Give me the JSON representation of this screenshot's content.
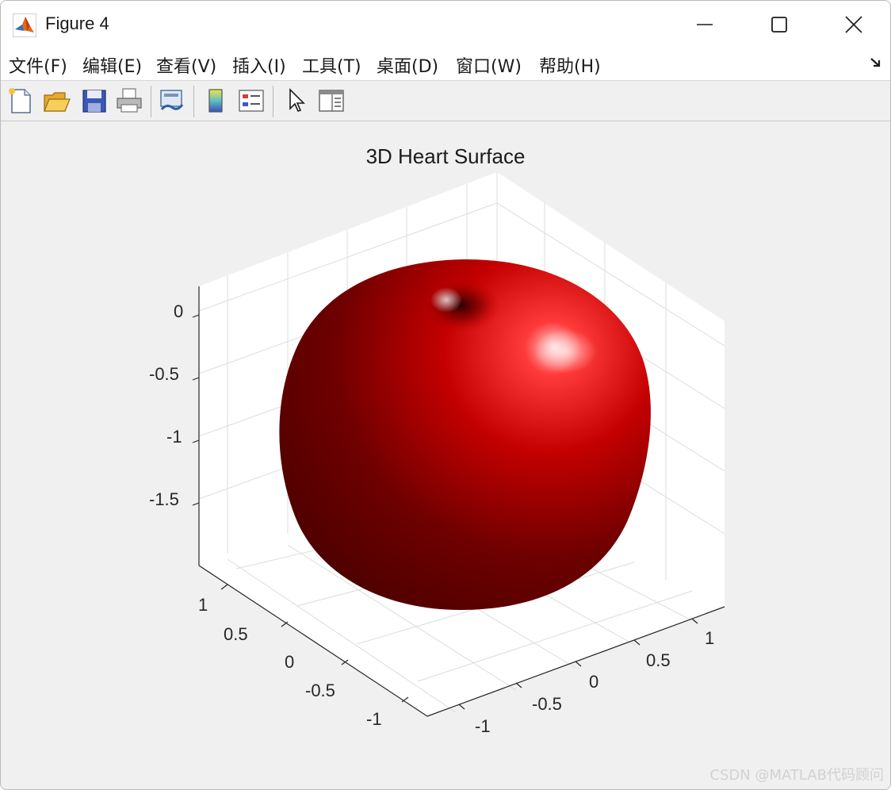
{
  "window": {
    "title": "Figure 4"
  },
  "menu": {
    "items": [
      "文件(F)",
      "编辑(E)",
      "查看(V)",
      "插入(I)",
      "工具(T)",
      "桌面(D)",
      "窗口(W)",
      "帮助(H)"
    ]
  },
  "toolbar": {
    "icons": [
      "new-figure-icon",
      "open-file-icon",
      "save-icon",
      "print-icon",
      "link-plot-icon",
      "colorbar-icon",
      "legend-icon",
      "edit-plot-icon",
      "property-inspector-icon"
    ]
  },
  "plot": {
    "title": "3D Heart Surface",
    "z_ticks": [
      "0",
      "-0.5",
      "-1",
      "-1.5"
    ],
    "y_ticks": [
      "1",
      "0.5",
      "0",
      "-0.5",
      "-1"
    ],
    "x_ticks": [
      "1",
      "0.5",
      "0",
      "-0.5",
      "-1"
    ],
    "colors": {
      "surface_light": "#ff3a3a",
      "surface_mid": "#c40000",
      "surface_dark": "#4a0000",
      "axes_bg": "#ffffff"
    }
  },
  "watermark": "CSDN @MATLAB代码顾问"
}
